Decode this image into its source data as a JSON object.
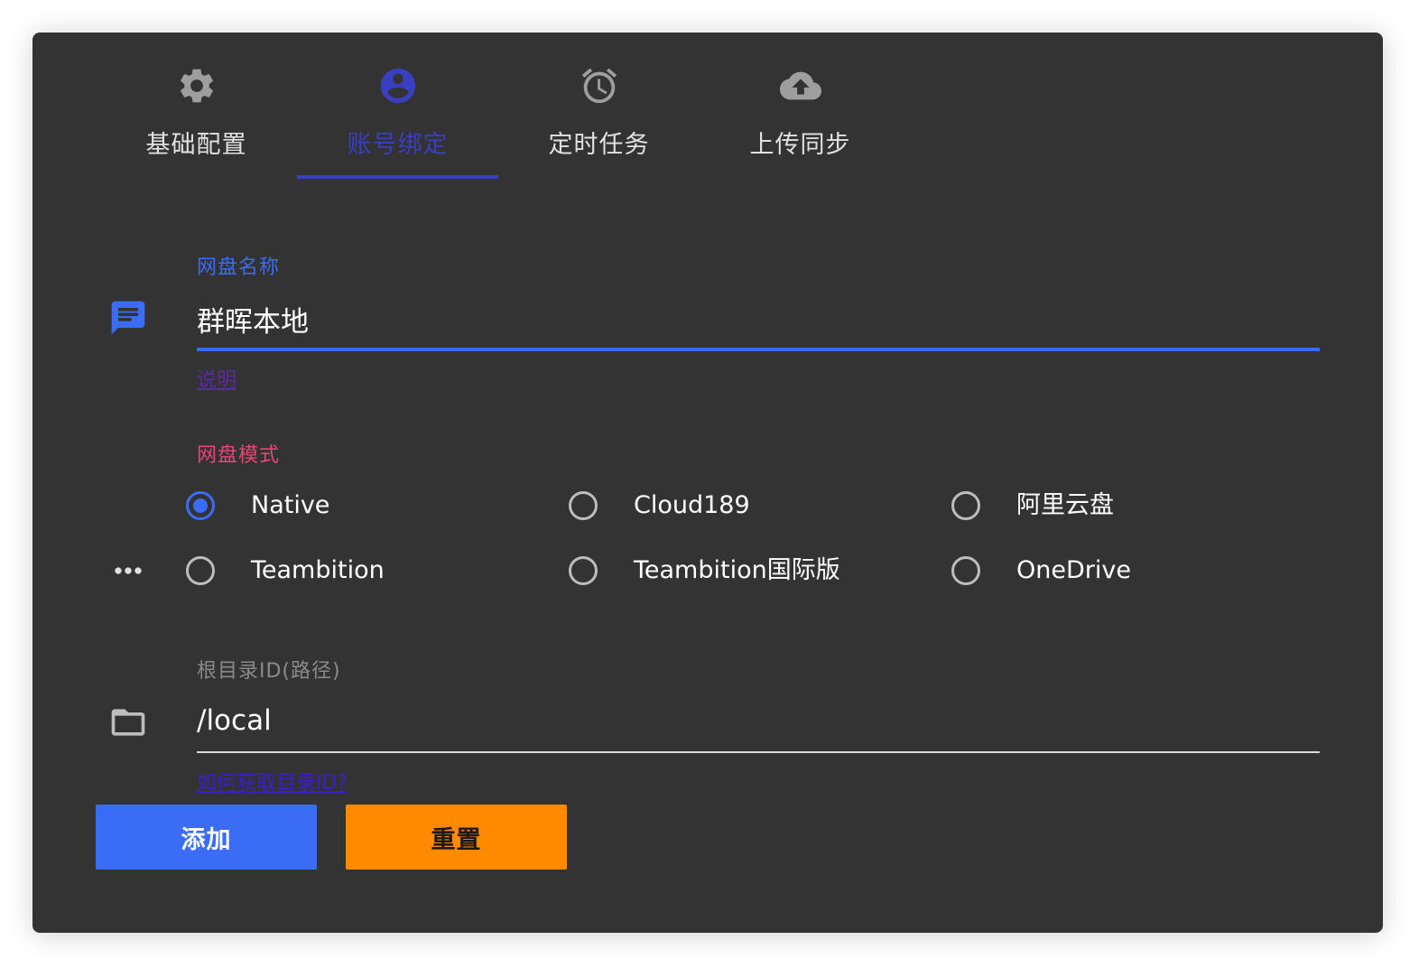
{
  "tabs": [
    {
      "label": "基础配置",
      "icon": "gear-icon"
    },
    {
      "label": "账号绑定",
      "icon": "account-circle-icon"
    },
    {
      "label": "定时任务",
      "icon": "alarm-clock-icon"
    },
    {
      "label": "上传同步",
      "icon": "cloud-upload-icon"
    }
  ],
  "active_tab": "账号绑定",
  "name_field": {
    "label": "网盘名称",
    "value": "群晖本地",
    "hint": "说明",
    "icon": "message-icon"
  },
  "mode_field": {
    "label": "网盘模式",
    "icon": "more-horizontal-icon",
    "options": [
      "Native",
      "Cloud189",
      "阿里云盘",
      "Teambition",
      "Teambition国际版",
      "OneDrive"
    ],
    "selected": "Native"
  },
  "root_field": {
    "label": "根目录ID(路径)",
    "value": "/local",
    "hint": "如何获取目录ID? ",
    "icon": "folder-icon"
  },
  "buttons": {
    "add_label": "添加",
    "reset_label": "重置"
  },
  "colors": {
    "background": "#333333",
    "primary": "#3b6cf6",
    "active_tab": "#3a3ec0",
    "mode_label": "#e8457a",
    "reset": "#ff8a00",
    "link": "#3c1bd6",
    "hint": "#5a2a9e"
  }
}
